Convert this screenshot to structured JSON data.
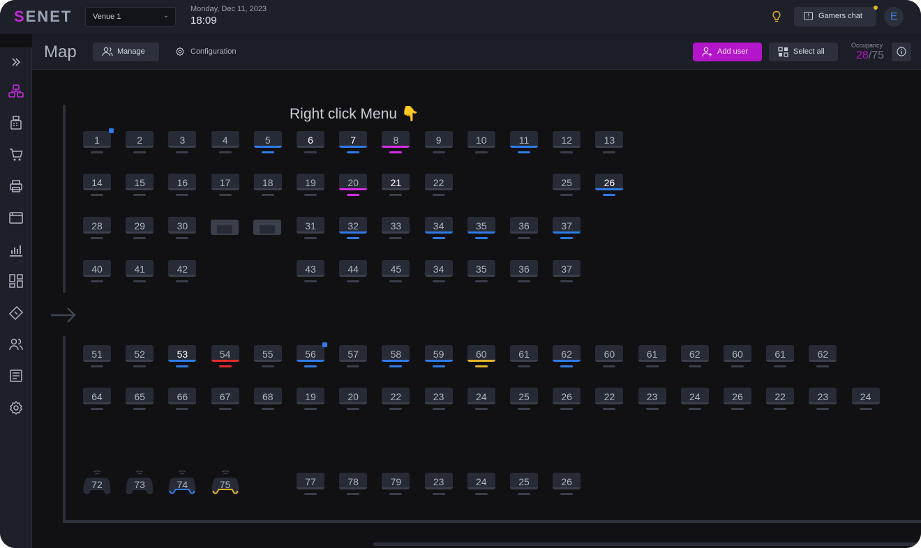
{
  "header": {
    "logo_first": "S",
    "logo_rest": "ENET",
    "venue": "Venue 1",
    "date": "Monday, Dec 11, 2023",
    "time": "18:09",
    "chat_label": "Gamers chat",
    "avatar_initial": "E"
  },
  "toolbar": {
    "title": "Map",
    "manage_label": "Manage",
    "config_label": "Configuration",
    "add_user_label": "Add user",
    "select_all_label": "Select all",
    "occupancy_label": "Occupancy",
    "occupancy_current": "28",
    "occupancy_sep": "/",
    "occupancy_total": "75"
  },
  "map": {
    "menu_title": "Right click Menu 👇",
    "colors": {
      "blue": "#2f7be8",
      "pink": "#d92ce8",
      "red": "#e22b2b",
      "yellow": "#e2b42a",
      "brand": "#b315c9"
    },
    "pcs": {
      "r1": [
        {
          "n": "1",
          "flag": true
        },
        {
          "n": "2"
        },
        {
          "n": "3"
        },
        {
          "n": "4"
        },
        {
          "n": "5",
          "s": "blue"
        },
        {
          "n": "6",
          "hl": true
        },
        {
          "n": "7",
          "s": "blue",
          "hl": true
        },
        {
          "n": "8",
          "s": "pink"
        },
        {
          "n": "9"
        },
        {
          "n": "10"
        },
        {
          "n": "11",
          "s": "blue"
        },
        {
          "n": "12"
        },
        {
          "n": "13"
        }
      ],
      "r2": [
        {
          "n": "14"
        },
        {
          "n": "15"
        },
        {
          "n": "16"
        },
        {
          "n": "17"
        },
        {
          "n": "18"
        },
        {
          "n": "19"
        },
        {
          "n": "20",
          "s": "pink"
        },
        {
          "n": "21",
          "hl": true
        },
        {
          "n": "22"
        },
        {
          "n": "25"
        },
        {
          "n": "26",
          "s": "blue",
          "hl": true
        }
      ],
      "r3": [
        {
          "n": "28"
        },
        {
          "n": "29"
        },
        {
          "n": "30"
        },
        {
          "n": "31"
        },
        {
          "n": "32",
          "s": "blue"
        },
        {
          "n": "33"
        },
        {
          "n": "34",
          "s": "blue"
        },
        {
          "n": "35",
          "s": "blue"
        },
        {
          "n": "36"
        },
        {
          "n": "37",
          "s": "blue"
        }
      ],
      "r4": [
        {
          "n": "40"
        },
        {
          "n": "41"
        },
        {
          "n": "42"
        },
        {
          "n": "43"
        },
        {
          "n": "44"
        },
        {
          "n": "45"
        },
        {
          "n": "34"
        },
        {
          "n": "35"
        },
        {
          "n": "36"
        },
        {
          "n": "37"
        }
      ],
      "r5": [
        {
          "n": "51"
        },
        {
          "n": "52"
        },
        {
          "n": "53",
          "s": "blue",
          "hl": true
        },
        {
          "n": "54",
          "s": "red"
        },
        {
          "n": "55"
        },
        {
          "n": "56",
          "s": "blue",
          "flag": true
        },
        {
          "n": "57"
        },
        {
          "n": "58",
          "s": "blue"
        },
        {
          "n": "59",
          "s": "blue"
        },
        {
          "n": "60",
          "s": "yellow"
        },
        {
          "n": "61"
        },
        {
          "n": "62",
          "s": "blue"
        },
        {
          "n": "60"
        },
        {
          "n": "61"
        },
        {
          "n": "62"
        },
        {
          "n": "60"
        },
        {
          "n": "61"
        },
        {
          "n": "62"
        }
      ],
      "r6": [
        {
          "n": "64"
        },
        {
          "n": "65"
        },
        {
          "n": "66"
        },
        {
          "n": "67"
        },
        {
          "n": "68"
        },
        {
          "n": "19"
        },
        {
          "n": "20"
        },
        {
          "n": "22"
        },
        {
          "n": "23"
        },
        {
          "n": "24"
        },
        {
          "n": "25"
        },
        {
          "n": "26"
        },
        {
          "n": "22"
        },
        {
          "n": "23"
        },
        {
          "n": "24"
        },
        {
          "n": "26"
        },
        {
          "n": "22"
        },
        {
          "n": "23"
        },
        {
          "n": "24"
        }
      ],
      "r7": [
        {
          "n": "77"
        },
        {
          "n": "78"
        },
        {
          "n": "79"
        },
        {
          "n": "23"
        },
        {
          "n": "24"
        },
        {
          "n": "25"
        },
        {
          "n": "26"
        }
      ]
    },
    "consoles": [
      {
        "n": "72"
      },
      {
        "n": "73"
      },
      {
        "n": "74",
        "s": "blue"
      },
      {
        "n": "75",
        "s": "yellow"
      }
    ]
  }
}
